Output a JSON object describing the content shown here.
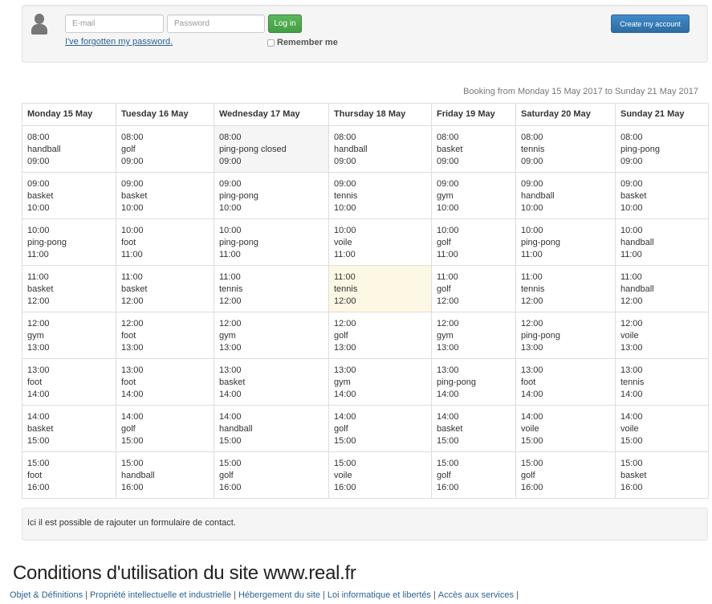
{
  "login": {
    "email_placeholder": "E-mail",
    "password_placeholder": "Password",
    "login_label": "Log in",
    "forgot_label": "I've forgotten my password.",
    "remember_label": "Remember me",
    "create_account_label": "Create my account"
  },
  "booking_range": "Booking from Monday 15 May 2017 to Sunday 21 May 2017",
  "days": [
    "Monday 15 May",
    "Tuesday 16 May",
    "Wednesday 17 May",
    "Thursday 18 May",
    "Friday 19 May",
    "Saturday 20 May",
    "Sunday 21 May"
  ],
  "slots": [
    {
      "start": "08:00",
      "end": "09:00",
      "activities": [
        "handball",
        "golf",
        "ping-pong closed",
        "handball",
        "basket",
        "tennis",
        "ping-pong"
      ]
    },
    {
      "start": "09:00",
      "end": "10:00",
      "activities": [
        "basket",
        "basket",
        "ping-pong",
        "tennis",
        "gym",
        "handball",
        "basket"
      ]
    },
    {
      "start": "10:00",
      "end": "11:00",
      "activities": [
        "ping-pong",
        "foot",
        "ping-pong",
        "voile",
        "golf",
        "ping-pong",
        "handball"
      ]
    },
    {
      "start": "11:00",
      "end": "12:00",
      "activities": [
        "basket",
        "basket",
        "tennis",
        "tennis",
        "golf",
        "tennis",
        "handball"
      ]
    },
    {
      "start": "12:00",
      "end": "13:00",
      "activities": [
        "gym",
        "foot",
        "gym",
        "golf",
        "gym",
        "ping-pong",
        "voile"
      ]
    },
    {
      "start": "13:00",
      "end": "14:00",
      "activities": [
        "foot",
        "foot",
        "basket",
        "gym",
        "ping-pong",
        "foot",
        "tennis"
      ]
    },
    {
      "start": "14:00",
      "end": "15:00",
      "activities": [
        "basket",
        "golf",
        "handball",
        "golf",
        "basket",
        "voile",
        "voile"
      ]
    },
    {
      "start": "15:00",
      "end": "16:00",
      "activities": [
        "foot",
        "handball",
        "golf",
        "voile",
        "golf",
        "golf",
        "basket"
      ]
    }
  ],
  "contact_text": "Ici il est possible de rajouter un formulaire de contact.",
  "footer": {
    "title": "Conditions d'utilisation du site www.real.fr",
    "links": [
      "Objet & Définitions",
      "Propriété intellectuelle et industrielle",
      "Hébergement du site",
      "Loi informatique et libertés",
      "Accès aux services"
    ]
  },
  "colors": {
    "login_button": "#5cb85c",
    "create_button": "#428bca",
    "closed_cell": "#f5f5f5",
    "highlight_cell": "#fcf8e3",
    "link": "#2a6496"
  },
  "icons": [
    "user-icon"
  ]
}
